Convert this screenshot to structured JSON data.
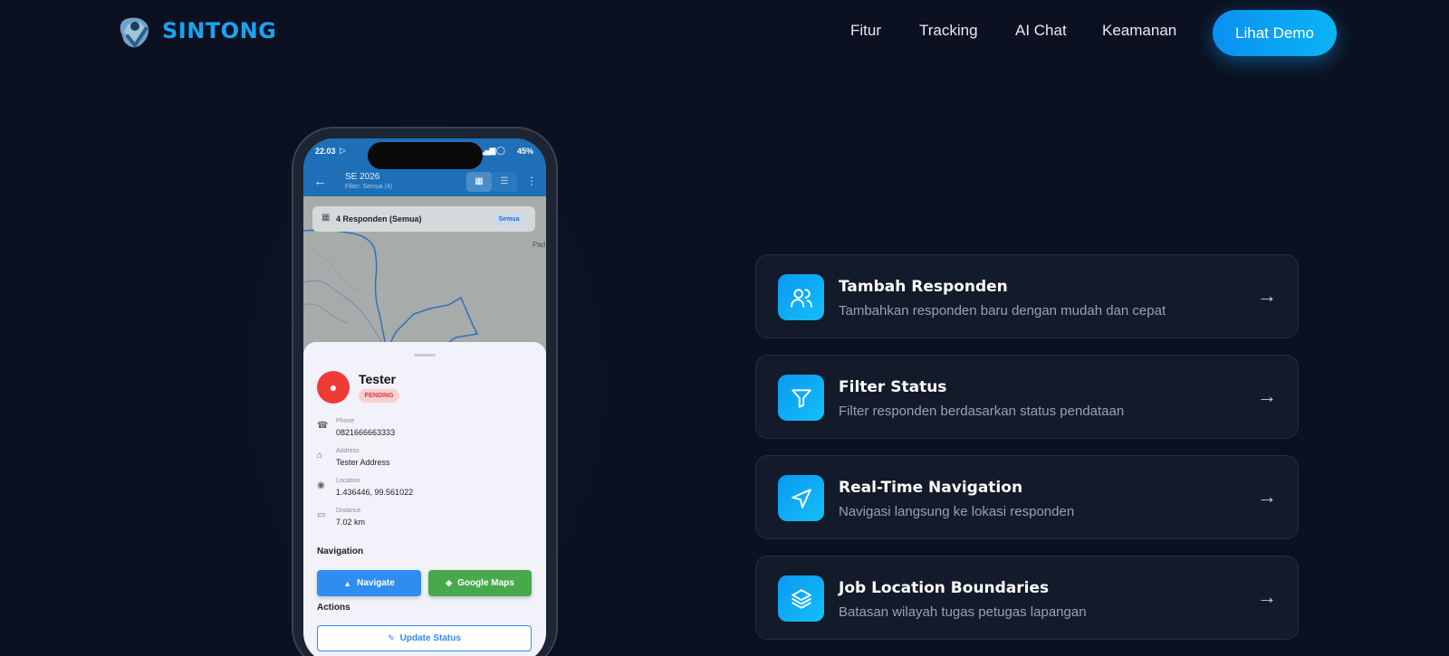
{
  "brand": {
    "name": "SINTONG",
    "accent": "#1aa3f0"
  },
  "nav": {
    "items": [
      "Fitur",
      "Tracking",
      "AI Chat",
      "Keamanan"
    ],
    "cta_label": "Lihat Demo"
  },
  "phone": {
    "status": {
      "time": "22.03",
      "battery": "45%"
    },
    "appbar": {
      "title": "SE 2026",
      "subtitle": "Filter: Semua (4)"
    },
    "map": {
      "summary": "4 Responden (Semua)",
      "filter_chip": "Semua",
      "place_label": "Pad"
    },
    "detail": {
      "name": "Tester",
      "status": "PENDING",
      "fields": [
        {
          "label": "Phone",
          "value": "0821666663333",
          "icon": "phone-icon"
        },
        {
          "label": "Address",
          "value": "Tester Address",
          "icon": "home-icon"
        },
        {
          "label": "Location",
          "value": "1.436446, 99.561022",
          "icon": "location-pin-icon"
        },
        {
          "label": "Distance",
          "value": "7.02 km",
          "icon": "ruler-icon"
        }
      ],
      "navigation_title": "Navigation",
      "navigate_label": "Navigate",
      "google_maps_label": "Google Maps",
      "actions_title": "Actions",
      "update_status_label": "Update Status"
    }
  },
  "features": [
    {
      "title": "Tambah Responden",
      "description": "Tambahkan responden baru dengan mudah dan cepat",
      "icon": "users-icon"
    },
    {
      "title": "Filter Status",
      "description": "Filter responden berdasarkan status pendataan",
      "icon": "filter-icon"
    },
    {
      "title": "Real-Time Navigation",
      "description": "Navigasi langsung ke lokasi responden",
      "icon": "navigation-icon"
    },
    {
      "title": "Job Location Boundaries",
      "description": "Batasan wilayah tugas petugas lapangan",
      "icon": "layers-icon"
    }
  ]
}
